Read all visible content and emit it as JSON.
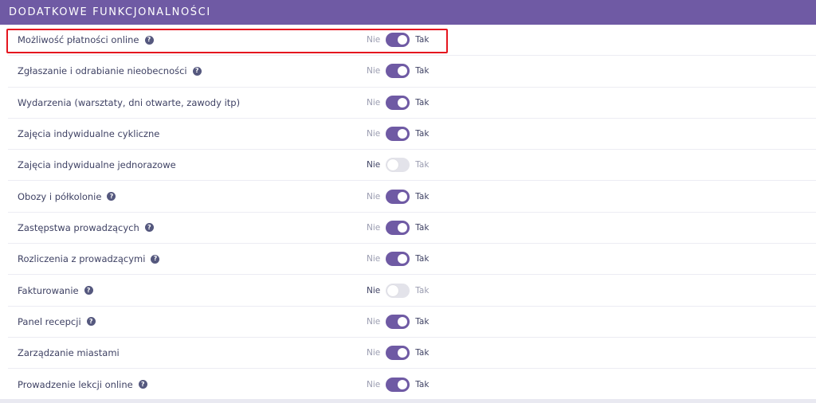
{
  "header": {
    "title": "DODATKOWE FUNKCJONALNOŚCI"
  },
  "toggle_labels": {
    "off": "Nie",
    "on": "Tak"
  },
  "colors": {
    "accent": "#6f5aa4",
    "highlight": "#e5161f",
    "toggle_off": "#e3e3ea"
  },
  "rows": [
    {
      "label": "Możliwość płatności online",
      "help": true,
      "enabled": true
    },
    {
      "label": "Zgłaszanie i odrabianie nieobecności",
      "help": true,
      "enabled": true
    },
    {
      "label": "Wydarzenia (warsztaty, dni otwarte, zawody itp)",
      "help": false,
      "enabled": true
    },
    {
      "label": "Zajęcia indywidualne cykliczne",
      "help": false,
      "enabled": true
    },
    {
      "label": "Zajęcia indywidualne jednorazowe",
      "help": false,
      "enabled": false
    },
    {
      "label": "Obozy i półkolonie",
      "help": true,
      "enabled": true
    },
    {
      "label": "Zastępstwa prowadzących",
      "help": true,
      "enabled": true
    },
    {
      "label": "Rozliczenia z prowadzącymi",
      "help": true,
      "enabled": true
    },
    {
      "label": "Fakturowanie",
      "help": true,
      "enabled": false
    },
    {
      "label": "Panel recepcji",
      "help": true,
      "enabled": true
    },
    {
      "label": "Zarządzanie miastami",
      "help": false,
      "enabled": true
    },
    {
      "label": "Prowadzenie lekcji online",
      "help": true,
      "enabled": true
    }
  ],
  "help_glyph": "?"
}
